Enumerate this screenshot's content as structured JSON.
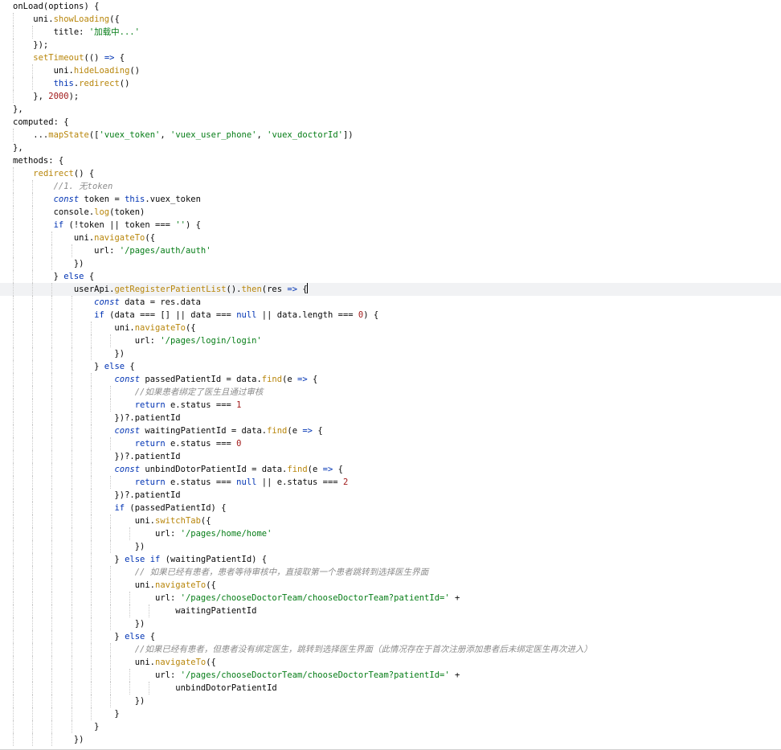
{
  "editor": {
    "language": "javascript",
    "current_line_index": 22,
    "lines": [
      "onLoad(options) {",
      "    uni.showLoading({",
      "        title: '加载中...'",
      "    });",
      "    setTimeout(() => {",
      "        uni.hideLoading()",
      "        this.redirect()",
      "    }, 2000);",
      "},",
      "computed: {",
      "    ...mapState(['vuex_token', 'vuex_user_phone', 'vuex_doctorId'])",
      "},",
      "methods: {",
      "    redirect() {",
      "        //1. 无token",
      "        const token = this.vuex_token",
      "        console.log(token)",
      "        if (!token || token === '') {",
      "            uni.navigateTo({",
      "                url: '/pages/auth/auth'",
      "            })",
      "        } else {",
      "            userApi.getRegisterPatientList().then(res => {",
      "                const data = res.data",
      "                if (data === [] || data === null || data.length === 0) {",
      "                    uni.navigateTo({",
      "                        url: '/pages/login/login'",
      "                    })",
      "                } else {",
      "                    const passedPatientId = data.find(e => {",
      "                        //如果患者绑定了医生且通过审核",
      "                        return e.status === 1",
      "                    })?.patientId",
      "                    const waitingPatientId = data.find(e => {",
      "                        return e.status === 0",
      "                    })?.patientId",
      "                    const unbindDotorPatientId = data.find(e => {",
      "                        return e.status === null || e.status === 2",
      "                    })?.patientId",
      "                    if (passedPatientId) {",
      "                        uni.switchTab({",
      "                            url: '/pages/home/home'",
      "                        })",
      "                    } else if (waitingPatientId) {",
      "                        // 如果已经有患者，患者等待审核中，直接取第一个患者跳转到选择医生界面",
      "                        uni.navigateTo({",
      "                            url: '/pages/chooseDoctorTeam/chooseDoctorTeam?patientId=' +",
      "                                waitingPatientId",
      "                        })",
      "                    } else {",
      "                        //如果已经有患者，但患者没有绑定医生，跳转到选择医生界面（此情况存在于首次注册添加患者后未绑定医生再次进入）",
      "                        uni.navigateTo({",
      "                            url: '/pages/chooseDoctorTeam/chooseDoctorTeam?patientId=' +",
      "                                unbindDotorPatientId",
      "                        })",
      "                    }",
      "                }",
      "            })"
    ]
  }
}
